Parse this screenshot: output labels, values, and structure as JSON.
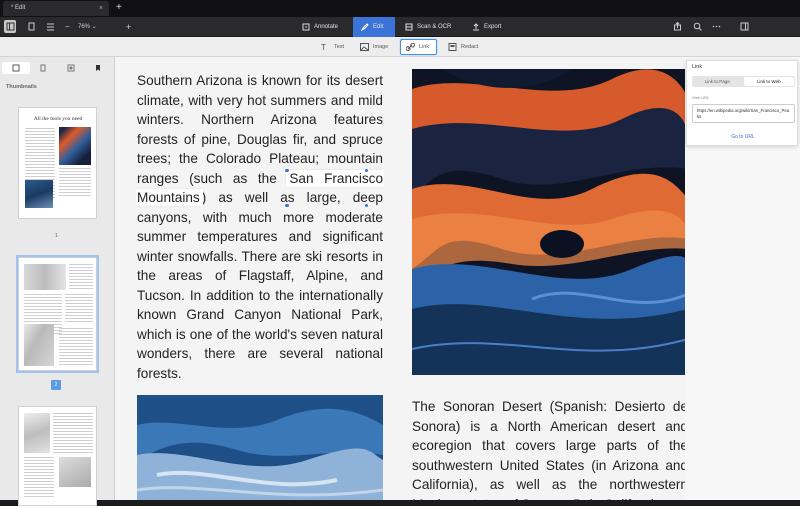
{
  "tabs": [
    {
      "label": "* Edit",
      "close": "×"
    }
  ],
  "new_tab": "+",
  "toolbar": {
    "zoom_minus": "−",
    "zoom": "76% ⌄",
    "zoom_plus": "+",
    "modes": [
      {
        "label": "Annotate",
        "icon": "annotate-icon"
      },
      {
        "label": "Edit",
        "icon": "edit-icon",
        "active": true
      },
      {
        "label": "Scan & OCR",
        "icon": "scan-icon"
      },
      {
        "label": "Export",
        "icon": "export-icon"
      }
    ]
  },
  "edit_tools": [
    {
      "label": "Text",
      "icon": "text-tool-icon"
    },
    {
      "label": "Image",
      "icon": "image-tool-icon"
    },
    {
      "label": "Link",
      "icon": "link-tool-icon",
      "active": true
    },
    {
      "label": "Redact",
      "icon": "redact-tool-icon"
    }
  ],
  "sidebar": {
    "label": "Thumbnails",
    "thumb1_title": "All the tools you need",
    "pages": [
      "1",
      "2"
    ]
  },
  "document": {
    "para1_before": "Southern Arizona is known for its desert climate, with very hot summers and mild winters. Northern Arizona features forests of pine, Douglas fir, and spruce trees; the Colorado Plateau; mountain ranges (such as the ",
    "para1_highlight": "San Francisco Mountains",
    "para1_after": ") as well as large, deep canyons, with much more moderate summer temperatures and significant winter snowfalls. There are ski resorts in the areas of Flagstaff, Alpine, and Tucson. In addition to the internationally known Grand Canyon National Park, which is one of the world's seven natural wonders, there are several national forests.",
    "para2": "The Sonoran Desert (Spanish: Desierto de Sonora) is a North American desert and ecoregion that covers large parts of the southwestern United States (in Arizona and California), as well as the northwestern Mexican states of Sonora, Baja California"
  },
  "link_panel": {
    "title": "Link",
    "seg_page": "Link to Page",
    "seg_web": "Link to Web",
    "url_label": "Web URL",
    "url": "https://en.wikipedia.org/wiki/San_Francisco_Peaks",
    "go": "Go to URL"
  },
  "colors": {
    "accent": "#3b74d8",
    "toolbar": "#2a2a2d",
    "page_bg": "#f4f4f4"
  }
}
